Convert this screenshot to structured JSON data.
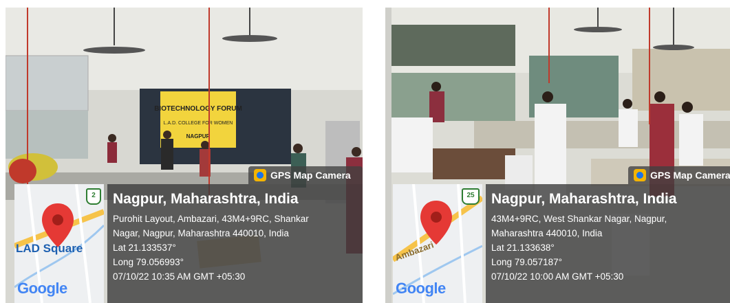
{
  "photos": [
    {
      "badge": "GPS Map Camera",
      "city": "Nagpur, Maharashtra, India",
      "address1": "Purohit Layout, Ambazari, 43M4+9RC, Shankar",
      "address2": "Nagar, Nagpur, Maharashtra 440010, India",
      "lat": "Lat 21.133537°",
      "long": "Long 79.056993°",
      "timestamp": "07/10/22 10:35 AM GMT +05:30",
      "map_label": "LAD Square",
      "map_brand": "Google",
      "route_shield": "2",
      "banner_line1": "BIOTECHNOLOGY FORUM",
      "banner_line2": "L.A.D. COLLEGE FOR WOMEN",
      "banner_line3": "NAGPUR"
    },
    {
      "badge": "GPS Map Camera",
      "city": "Nagpur, Maharashtra, India",
      "address1": "43M4+9RC, West Shankar Nagar, Nagpur,",
      "address2": "Maharashtra 440010, India",
      "lat": "Lat 21.133638°",
      "long": "Long 79.057187°",
      "timestamp": "07/10/22 10:00 AM GMT +05:30",
      "map_label": "Ambazari",
      "map_brand": "Google",
      "route_shield": "25"
    }
  ],
  "colors": {
    "overlay": "#3c3c3c",
    "map_pin": "#e53935",
    "banner_yellow": "#f2d43d",
    "board": "#2b3440"
  }
}
